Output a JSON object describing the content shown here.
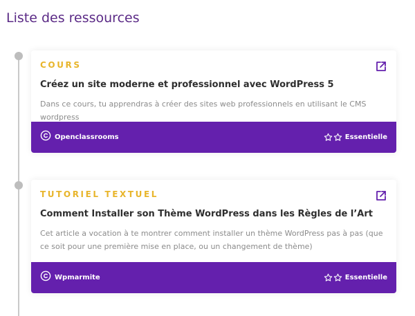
{
  "page": {
    "title": "Liste des ressources"
  },
  "colors": {
    "accent": "#6420ad",
    "category": "#e8b52b",
    "title": "#5b2a86"
  },
  "resources": [
    {
      "category": "COURS",
      "title": "Créez un site moderne et professionnel avec WordPress 5",
      "description": "Dans ce cours, tu apprendras à créer des sites web professionnels en utilisant le CMS wordpress",
      "source": "Openclassrooms",
      "level": "Essentielle",
      "source_icon": "copyright-icon",
      "level_icon": "star-outline-icon",
      "stars": 2
    },
    {
      "category": "TUTORIEL TEXTUEL",
      "title": "Comment Installer son Thème WordPress dans les Règles de l’Art",
      "description": "Cet article a vocation à te montrer comment installer un thème WordPress pas à pas (que ce soit pour une première mise en place, ou un changement de thème)",
      "source": "Wpmarmite",
      "level": "Essentielle",
      "source_icon": "copyright-icon",
      "level_icon": "star-outline-icon",
      "stars": 2
    }
  ]
}
